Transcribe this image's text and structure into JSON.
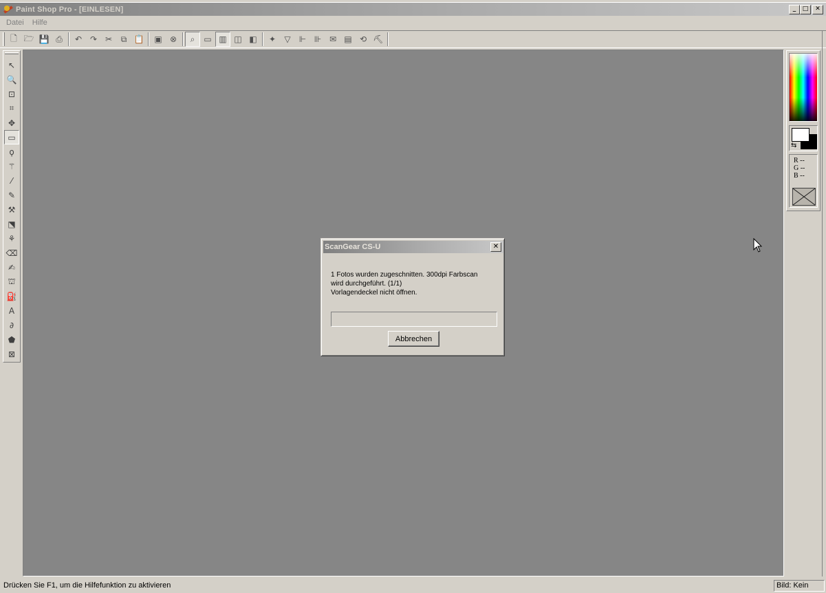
{
  "window": {
    "title": "Paint Shop Pro - [EINLESEN]",
    "minimize": "_",
    "maximize": "□",
    "close": "✕"
  },
  "menu": {
    "items": [
      "Datei",
      "Hilfe"
    ]
  },
  "toolbar": {
    "icons": [
      {
        "name": "new-icon",
        "glyph": "🗋"
      },
      {
        "name": "open-icon",
        "glyph": "🗁"
      },
      {
        "name": "save-icon",
        "glyph": "💾"
      },
      {
        "name": "print-icon",
        "glyph": "⎙"
      },
      {
        "name": "undo-icon",
        "glyph": "↶"
      },
      {
        "name": "redo-icon",
        "glyph": "↷"
      },
      {
        "name": "cut-icon",
        "glyph": "✂"
      },
      {
        "name": "copy-icon",
        "glyph": "⧉"
      },
      {
        "name": "paste-icon",
        "glyph": "📋"
      },
      {
        "name": "view-icon",
        "glyph": "▣"
      },
      {
        "name": "browse-icon",
        "glyph": "⊗"
      },
      {
        "name": "toggle-tool-palette-icon",
        "glyph": "⌕"
      },
      {
        "name": "toggle-style-bar-icon",
        "glyph": "▭"
      },
      {
        "name": "toggle-color-palette-icon",
        "glyph": "▥"
      },
      {
        "name": "toggle-histogram-icon",
        "glyph": "◫"
      },
      {
        "name": "toggle-layers-icon",
        "glyph": "◧"
      },
      {
        "name": "magic-icon",
        "glyph": "✦"
      },
      {
        "name": "filter-icon",
        "glyph": "▽"
      },
      {
        "name": "align-icon",
        "glyph": "⊩"
      },
      {
        "name": "distribute-icon",
        "glyph": "⊪"
      },
      {
        "name": "mail-icon",
        "glyph": "✉"
      },
      {
        "name": "scanner-icon",
        "glyph": "▤"
      },
      {
        "name": "rotate-icon",
        "glyph": "⟲"
      },
      {
        "name": "brush-settings-icon",
        "glyph": "⛏"
      }
    ]
  },
  "tools": [
    {
      "name": "arrow-tool-icon",
      "glyph": "↖"
    },
    {
      "name": "zoom-tool-icon",
      "glyph": "🔍"
    },
    {
      "name": "deformation-tool-icon",
      "glyph": "⊡"
    },
    {
      "name": "crop-tool-icon",
      "glyph": "⌗"
    },
    {
      "name": "move-tool-icon",
      "glyph": "✥"
    },
    {
      "name": "selection-tool-icon",
      "glyph": "▭"
    },
    {
      "name": "lasso-tool-icon",
      "glyph": "ϙ"
    },
    {
      "name": "magic-wand-tool-icon",
      "glyph": "⚚"
    },
    {
      "name": "dropper-tool-icon",
      "glyph": "⁄"
    },
    {
      "name": "paintbrush-tool-icon",
      "glyph": "✎"
    },
    {
      "name": "clone-brush-tool-icon",
      "glyph": "⚒"
    },
    {
      "name": "color-replacer-tool-icon",
      "glyph": "⬔"
    },
    {
      "name": "retouch-tool-icon",
      "glyph": "⚘"
    },
    {
      "name": "eraser-tool-icon",
      "glyph": "⌫"
    },
    {
      "name": "picture-tube-tool-icon",
      "glyph": "✍"
    },
    {
      "name": "airbrush-tool-icon",
      "glyph": "⛫"
    },
    {
      "name": "flood-fill-tool-icon",
      "glyph": "⛽"
    },
    {
      "name": "text-tool-icon",
      "glyph": "A"
    },
    {
      "name": "draw-tool-icon",
      "glyph": "∂"
    },
    {
      "name": "preset-shapes-tool-icon",
      "glyph": "⬟"
    },
    {
      "name": "object-selector-tool-icon",
      "glyph": "⊠"
    }
  ],
  "color_panel": {
    "rgb_lines": [
      "R --",
      "G --",
      "B --"
    ],
    "swap_glyph": "⇆"
  },
  "dialog": {
    "title": "ScanGear CS-U",
    "close": "✕",
    "message_line1": "1 Fotos wurden zugeschnitten. 300dpi Farbscan",
    "message_line2": "wird durchgeführt. (1/1)",
    "message_line3": "Vorlagendeckel nicht öffnen.",
    "progress": 0,
    "cancel_label": "Abbrechen"
  },
  "status": {
    "hint": "Drücken Sie F1, um die Hilfefunktion zu aktivieren",
    "image": "Bild: Kein"
  }
}
